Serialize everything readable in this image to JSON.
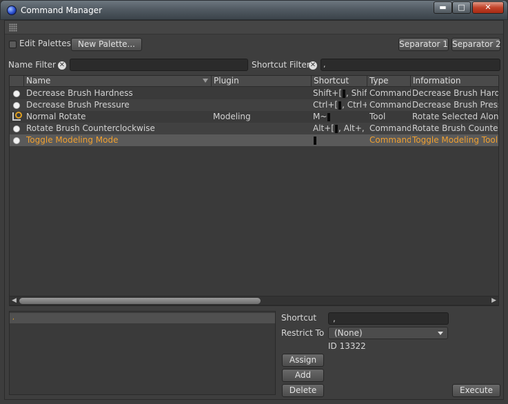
{
  "window": {
    "title": "Command Manager",
    "buttons": {
      "minimize": "▬",
      "maximize": "□",
      "close": "✕"
    }
  },
  "toolbar": {
    "edit_palettes_label": "Edit Palettes",
    "new_palette_label": "New Palette...",
    "separator1_label": "Separator 1",
    "separator2_label": "Separator 2"
  },
  "filters": {
    "name_filter_label": "Name Filter",
    "shortcut_filter_label": "Shortcut Filter",
    "name_filter_value": "",
    "shortcut_filter_value": ","
  },
  "table": {
    "columns": [
      "Name",
      "Plugin",
      "Shortcut",
      "Type",
      "Information"
    ],
    "rows": [
      {
        "icon": "circle-icon",
        "name": "Decrease Brush Hardness",
        "plugin": "",
        "shortcut_a": "Shift+[",
        "shortcut_b": ", Shift+,",
        "type": "Command",
        "info": "Decrease Brush Hardness"
      },
      {
        "icon": "circle-icon",
        "name": "Decrease Brush Pressure",
        "plugin": "",
        "shortcut_a": "Ctrl+[",
        "shortcut_b": ", Ctrl+,",
        "type": "Command",
        "info": "Decrease Brush Pressure"
      },
      {
        "icon": "rotate-tool-icon",
        "name": "Normal Rotate",
        "plugin": "Modeling",
        "shortcut_a": "M~",
        "shortcut_b": "",
        "type": "Tool",
        "info": "Rotate Selected Along"
      },
      {
        "icon": "circle-icon",
        "name": "Rotate Brush Counterclockwise",
        "plugin": "",
        "shortcut_a": "Alt+[",
        "shortcut_b": ", Alt+,",
        "type": "Command",
        "info": "Rotate Brush Counterclockwise"
      },
      {
        "icon": "circle-icon",
        "name": "Toggle Modeling Mode",
        "plugin": "",
        "shortcut_a": "",
        "shortcut_b": "",
        "type": "Command",
        "info": "Toggle Modeling Tool"
      }
    ]
  },
  "bottom": {
    "list_item": ",",
    "shortcut_label": "Shortcut",
    "shortcut_value": ",",
    "restrict_to_label": "Restrict To",
    "restrict_to_value": "(None)",
    "id_label": "ID 13322",
    "assign_label": "Assign",
    "add_label": "Add",
    "delete_label": "Delete",
    "execute_label": "Execute"
  },
  "colors": {
    "selected_text": "#f0a030",
    "background": "#3e3e3e"
  }
}
